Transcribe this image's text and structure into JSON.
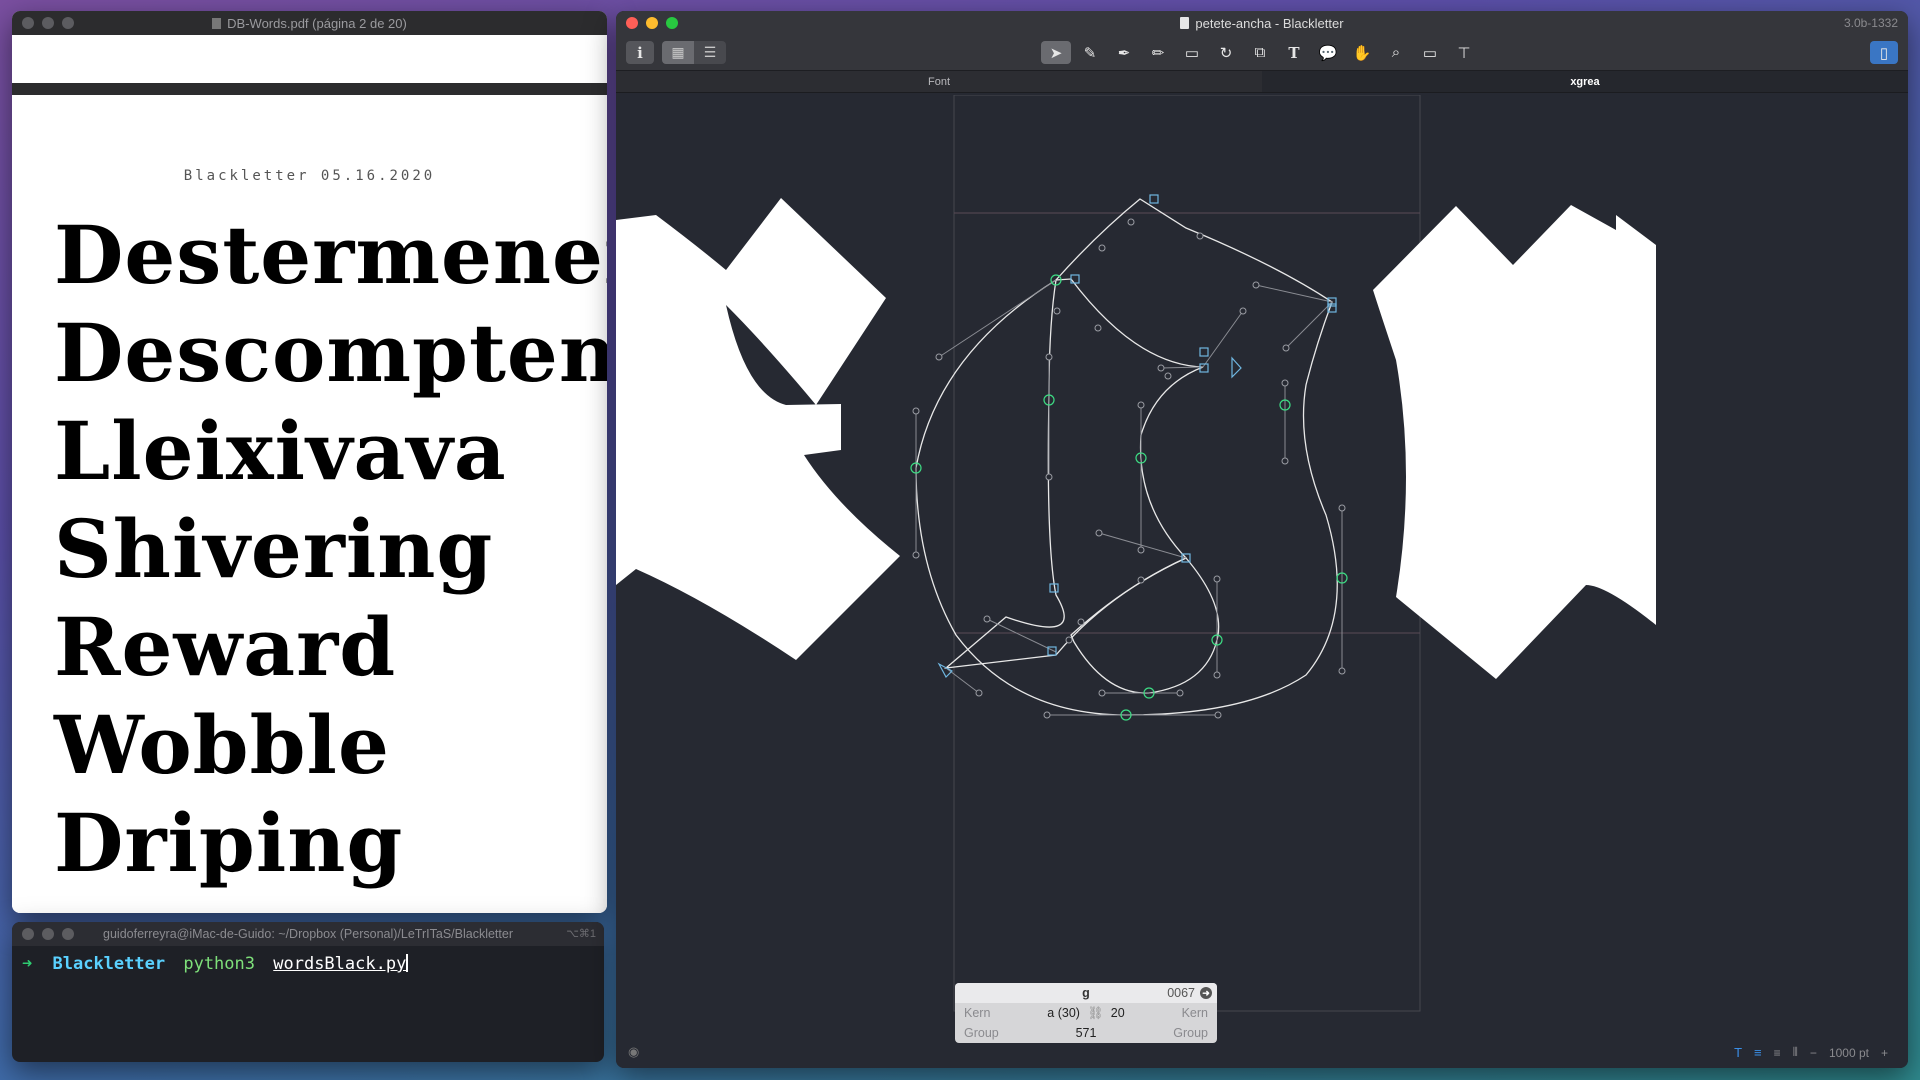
{
  "pdf": {
    "title": "DB-Words.pdf (página 2 de 20)",
    "heading": "Blackletter 05.16.2020",
    "words": [
      "Destermenem",
      "Descompten",
      "Lleixivava",
      "Shivering",
      "Reward",
      "Wobble",
      "Driping"
    ]
  },
  "terminal": {
    "title": "guidoferreyra@iMac-de-Guido: ~/Dropbox (Personal)/LeTrITaS/Blackletter",
    "shortcut": "⌥⌘1",
    "prompt": "➜",
    "dir": "Blackletter",
    "cmd": "python3",
    "arg": "wordsBlack.py"
  },
  "app": {
    "title": "petete-ancha - Blackletter",
    "version": "3.0b-1332",
    "info_button": "i",
    "tabs": [
      "Font",
      "xgrea"
    ],
    "tools": [
      "select-tool-icon",
      "draw-tool-icon",
      "pen-tool-icon",
      "pencil-tool-icon",
      "rectangle-tool-icon",
      "rotate-tool-icon",
      "scale-tool-icon",
      "text-tool-icon",
      "annotation-tool-icon",
      "hand-tool-icon",
      "zoom-tool-icon",
      "measure-tool-icon",
      "hint-tool-icon"
    ],
    "glyph_info": {
      "name": "g",
      "unicode": "0067",
      "kern_label_left": "Kern",
      "kern_label_right": "Kern",
      "kern_left_value": "a (30)",
      "kern_right_value": "20",
      "group_label_left": "Group",
      "group_label_right": "Group",
      "width": "571"
    },
    "zoom": "1000 pt",
    "colors": {
      "node_smooth": "#3ddc84",
      "node_corner": "#6fb6e0",
      "outline": "#ffffff",
      "canvas": "#262932"
    }
  }
}
